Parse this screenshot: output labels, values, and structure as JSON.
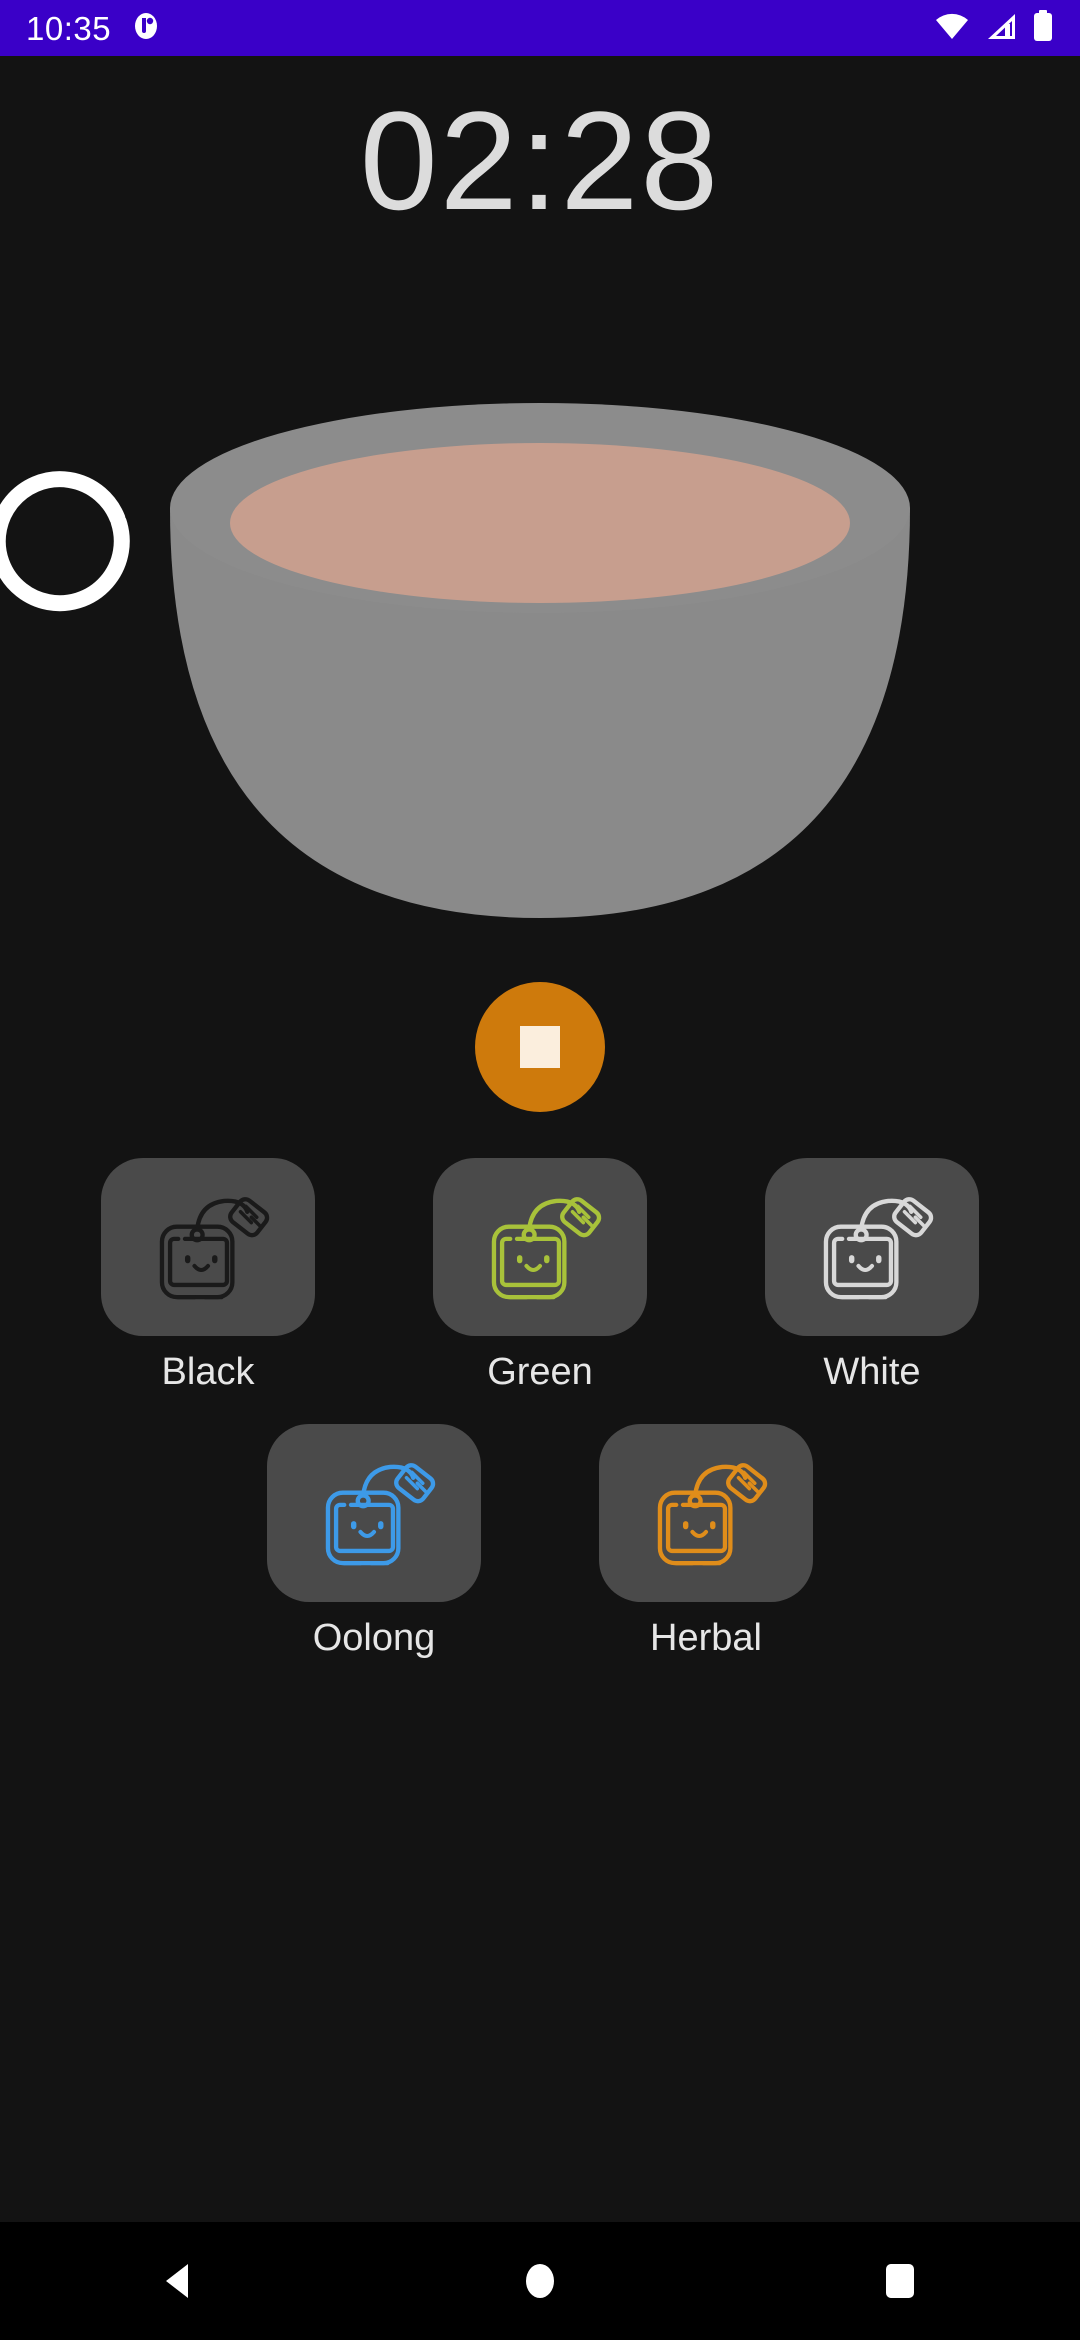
{
  "status_bar": {
    "clock": "10:35",
    "background": "#3A00C8",
    "icons": [
      {
        "name": "notification-badge-icon",
        "glyph": "notification"
      },
      {
        "name": "wifi-icon",
        "glyph": "wifi"
      },
      {
        "name": "cellular-signal-icon",
        "glyph": "signal"
      },
      {
        "name": "battery-icon",
        "glyph": "battery"
      }
    ]
  },
  "timer": {
    "display": "02:28",
    "progress_color": "#FFFFFF",
    "progress_fraction": 0.62
  },
  "cup": {
    "rim_color": "#8C8C8C",
    "body_color": "#8A8A8A",
    "liquid_color": "#C79E8E",
    "shadow_color": "#7C7C7C"
  },
  "controls": {
    "stop": {
      "label": "Stop",
      "icon": "stop-square-icon",
      "background": "#CE7A0C",
      "glyph_color": "#FBEEDD"
    }
  },
  "tea_types": {
    "tile_background": "#4A4A4A",
    "rows": [
      [
        {
          "id": "black",
          "label": "Black",
          "color": "#1A1A1A",
          "icon": "tea-bag-icon"
        },
        {
          "id": "green",
          "label": "Green",
          "color": "#A8C23A",
          "icon": "tea-bag-icon"
        },
        {
          "id": "white",
          "label": "White",
          "color": "#D8D8D8",
          "icon": "tea-bag-icon"
        }
      ],
      [
        {
          "id": "oolong",
          "label": "Oolong",
          "color": "#3D9AE8",
          "icon": "tea-bag-icon"
        },
        {
          "id": "herbal",
          "label": "Herbal",
          "color": "#E08D1A",
          "icon": "tea-bag-icon"
        }
      ]
    ]
  },
  "nav_bar": {
    "background": "#000000",
    "buttons": [
      {
        "name": "back-button",
        "icon": "triangle-left-icon"
      },
      {
        "name": "home-button",
        "icon": "circle-icon"
      },
      {
        "name": "recents-button",
        "icon": "square-icon"
      }
    ]
  }
}
